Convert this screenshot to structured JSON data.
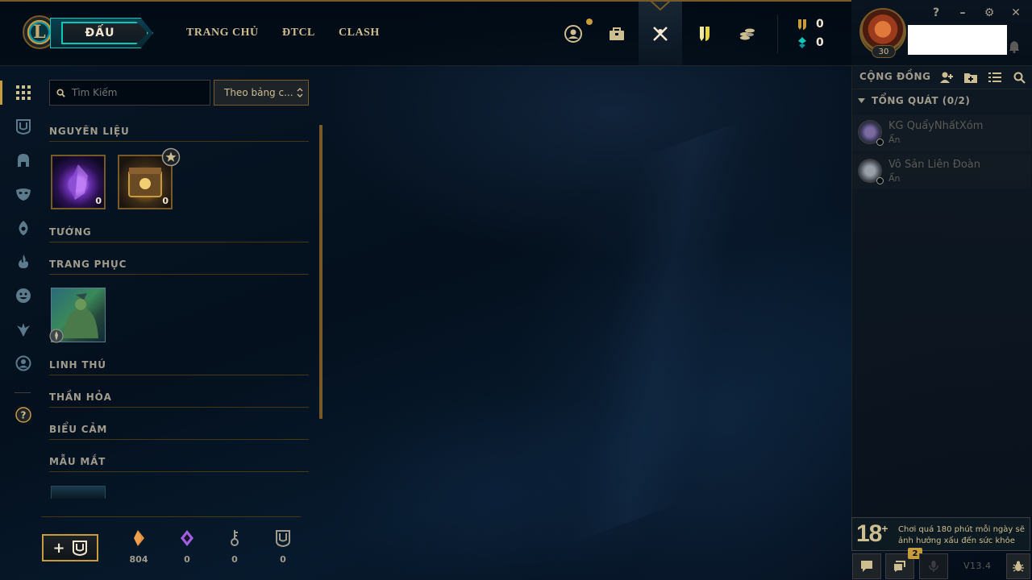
{
  "window": {
    "help": "?",
    "minimize": "–",
    "settings": "⚙",
    "close": "✕"
  },
  "nav": {
    "logo_letter": "L",
    "play_label": "ĐẤU",
    "links": [
      "TRANG CHỦ",
      "ĐTCL",
      "CLASH"
    ],
    "icons": [
      "profile-icon",
      "collection-icon",
      "loot-icon",
      "tft-pass-icon",
      "store-icon"
    ],
    "blue_essence": "0",
    "riot_points": "0"
  },
  "profile": {
    "level": "30"
  },
  "rail": {
    "icons": [
      "all-grid-icon",
      "chest-icon",
      "champion-helmet-icon",
      "skin-mask-icon",
      "ward-icon",
      "spell-flame-icon",
      "emote-icon",
      "eternals-icon",
      "icon-portrait-icon",
      "help-icon"
    ],
    "help_label": "?"
  },
  "loot": {
    "search": {
      "placeholder": "Tìm Kiếm"
    },
    "sort": {
      "value": "Theo bảng c..."
    },
    "sections": {
      "materials": "NGUYÊN LIỆU",
      "champions": "TƯỚNG",
      "skins": "TRANG PHỤC",
      "companions": "LINH THÚ",
      "eternals": "THẦN HỎA",
      "emotes": "BIỂU CẢM",
      "ward_skins": "MẪU MẮT"
    },
    "materials": [
      {
        "name": "mythic-essence",
        "count": "0"
      },
      {
        "name": "hextech-chest",
        "count": "0"
      }
    ],
    "footer": {
      "craft_plus": "+",
      "orange_essence": "804",
      "mythic_essence": "0",
      "keys": "0",
      "chests": "0"
    }
  },
  "social": {
    "header": "CỘNG ĐỒNG",
    "group": "TỔNG QUÁT (0/2)",
    "friends": [
      {
        "name": "KG QuẩyNhấtXóm",
        "status": "Ẩn"
      },
      {
        "name": "Vô Sản Liên Đoàn",
        "status": "Ẩn"
      }
    ]
  },
  "footer": {
    "age_rating": "18",
    "age_plus": "+",
    "notice": "Chơi quá 180 phút mỗi ngày sẽ ảnh hưởng xấu đến sức khỏe",
    "chat_badge": "2",
    "version": "V13.4"
  },
  "colors": {
    "gold": "#c89b3c",
    "gold_dark": "#785a28",
    "teal": "#0ac8b9",
    "text": "#cdbe91",
    "bg": "#010a13"
  }
}
